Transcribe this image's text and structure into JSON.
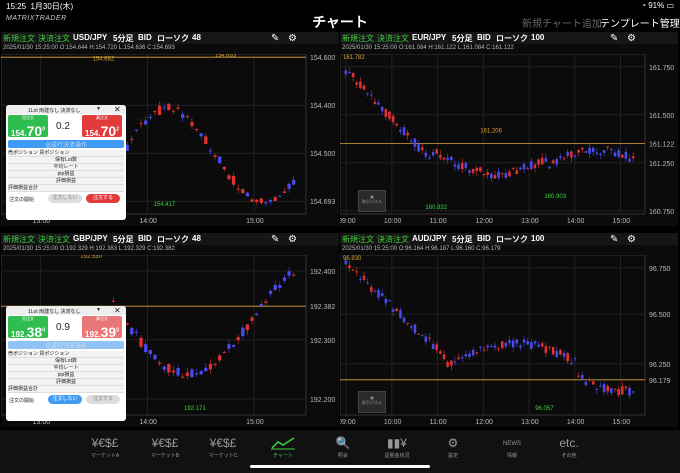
{
  "status": {
    "time": "15:25",
    "date": "1月30日(木)",
    "battery": "91%"
  },
  "header": {
    "logo": "MATRIXTRADER",
    "title": "チャート",
    "new_chart": "新規チャート追加",
    "template": "テンプレート管理"
  },
  "common": {
    "new_order": "新規注文",
    "settle_order": "決済注文",
    "bid": "BID",
    "candle": "ローソク",
    "timeframe": "5分足"
  },
  "panels": [
    {
      "pair": "USD/JPY",
      "count": "48",
      "ohlc": "2025/01/30 15:25:00  O:154.644  H:154.720  L:154.636  C:154.693",
      "yaxis": [
        "154.600",
        "154.400",
        "154.500",
        "154.693"
      ],
      "xaxis": [
        "13:00",
        "14:00",
        "15:00"
      ],
      "marks": {
        "high_left": "154.682",
        "high_right": "154.693",
        "low": "154.417"
      },
      "order": {
        "settings": "1Lot 両建なし 決済なし",
        "sell_label": "売注文",
        "sell_big": "154.",
        "sell_num": "70",
        "sell_sup": "0",
        "spread": "0.2",
        "buy_label": "買注文",
        "buy_big": "154.",
        "buy_num": "70",
        "buy_sup": "2",
        "exec_label": "全成行決済操作",
        "rows": [
          "売ポジション  買ポジション",
          "保有Lot数",
          "平均レート",
          "pip損益",
          "評価損益"
        ],
        "eval_total": "評価損益合計",
        "start_label": "注文の開始",
        "no_label": "注文しない",
        "yes_label": "注文する"
      }
    },
    {
      "pair": "EUR/JPY",
      "count": "100",
      "ohlc": "2025/01/30 15:25:00  O:161.084  H:161.122  L:161.084  C:161.122",
      "yaxis": [
        "161.750",
        "161.500",
        "161.250",
        "161.122",
        "160.750"
      ],
      "xaxis": [
        "09:00",
        "10:00",
        "11:00",
        "12:00",
        "13:00",
        "14:00",
        "15:00"
      ],
      "marks": {
        "high": "161.782",
        "mid": "161.206",
        "low1": "160.832",
        "low2": "160.903"
      },
      "mini_label": "取引パネル"
    },
    {
      "pair": "GBP/JPY",
      "count": "48",
      "ohlc": "2025/01/30 15:25:00  O:192.329  H:192.383  L:192.329  C:192.382",
      "yaxis": [
        "192.400",
        "192.382",
        "192.300",
        "192.200"
      ],
      "xaxis": [
        "13:00",
        "14:00",
        "15:00"
      ],
      "marks": {
        "high": "192.530",
        "low": "192.171"
      },
      "order": {
        "settings": "1Lot 両建なし 決済なし",
        "sell_label": "売注文",
        "sell_big": "192.",
        "sell_num": "38",
        "sell_sup": "0",
        "spread": "0.9",
        "buy_label": "買注文",
        "buy_big": "192.",
        "buy_num": "39",
        "buy_sup": "0",
        "exec_label": "全成行決済操作",
        "rows": [
          "売ポジション  買ポジション",
          "保有Lot数",
          "平均レート",
          "pip損益",
          "評価損益"
        ],
        "eval_total": "評価損益合計",
        "start_label": "注文の開始",
        "no_label": "注文しない",
        "yes_label": "注文する"
      }
    },
    {
      "pair": "AUD/JPY",
      "count": "100",
      "ohlc": "2025/01/30 15:25:00  O:96.164  H:96.187  L:96.160  C:96.179",
      "yaxis": [
        "96.750",
        "96.500",
        "96.250",
        "96.179"
      ],
      "xaxis": [
        "09:00",
        "10:00",
        "11:00",
        "12:00",
        "13:00",
        "14:00",
        "15:00"
      ],
      "marks": {
        "high": "96.830",
        "low": "96.057"
      },
      "mini_label": "取引パネル"
    }
  ],
  "nav": [
    {
      "icon": "¥€$£",
      "label": "マーケットA"
    },
    {
      "icon": "¥€$£",
      "label": "マーケットB"
    },
    {
      "icon": "¥€$£",
      "label": "マーケットC"
    },
    {
      "icon": "chart-icon",
      "label": "チャート"
    },
    {
      "icon": "🔍",
      "label": "照会"
    },
    {
      "icon": "▮▮¥",
      "label": "証拠金状況"
    },
    {
      "icon": "⚙",
      "label": "設定"
    },
    {
      "icon": "NEWS",
      "label": "情報"
    },
    {
      "icon": "etc.",
      "label": "その他"
    }
  ],
  "colors": {
    "accent_green": "#3cd43c",
    "accent_blue": "#3d7cf5",
    "sell_green": "#2ebd4e",
    "buy_red": "#e23b3b",
    "bull": "#e33131",
    "bear": "#4a4aee",
    "line_orange": "#d8a032"
  }
}
